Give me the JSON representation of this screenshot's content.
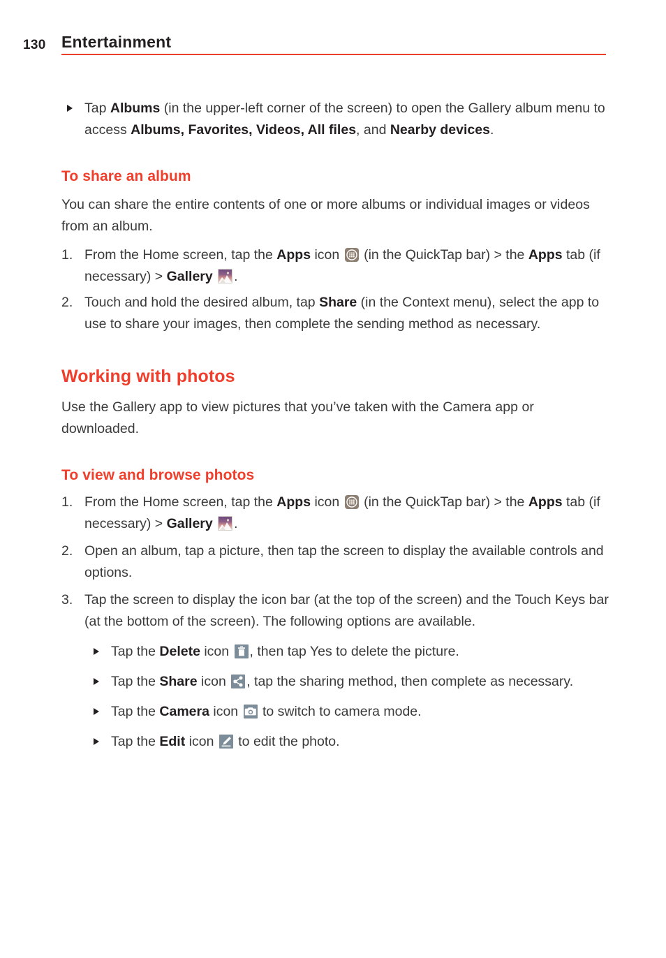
{
  "header": {
    "page_number": "130",
    "title": "Entertainment",
    "rule_color": "#e8402a"
  },
  "colors": {
    "heading_red": "#ef3e2b",
    "body_text": "#3a3a3a",
    "bold_text": "#231f20",
    "apps_icon_bg": "#8d7f72",
    "slate_icon_bg": "#7c8d99"
  },
  "content": {
    "intro_bullet": {
      "bullet_icon": "triangle-right-bullet",
      "part1": "Tap ",
      "bold1": "Albums",
      "part2": " (in the upper-left corner of the screen) to open the Gallery album menu to access ",
      "bold2": "Albums, Favorites, Videos, All files",
      "part3": ", and ",
      "bold3": "Nearby devices",
      "part4": "."
    },
    "share_album_section": {
      "heading": "To share an album",
      "intro": "You can share the entire contents of one or more albums or individual images or videos from an album.",
      "steps": [
        {
          "marker": "1.",
          "part1": "From the Home screen, tap the ",
          "bold1": "Apps",
          "part2": " icon ",
          "icon1": "apps-grid-icon",
          "part3": " (in the QuickTap bar) > the ",
          "bold2": "Apps",
          "part4": " tab (if necessary) > ",
          "bold3": "Gallery",
          "part5": " ",
          "icon2": "gallery-photo-icon",
          "part6": "."
        },
        {
          "marker": "2.",
          "part1": "Touch and hold the desired album, tap ",
          "bold1": "Share",
          "part2": " (in the Context menu), select the app to use to share your images, then complete the sending method as necessary."
        }
      ]
    },
    "working_with_photos_section": {
      "heading": "Working with photos",
      "intro": "Use the Gallery app to view pictures that you’ve taken with the Camera app or downloaded."
    },
    "view_browse_section": {
      "heading": "To view and browse photos",
      "steps": [
        {
          "marker": "1.",
          "part1": "From the Home screen, tap the ",
          "bold1": "Apps",
          "part2": " icon ",
          "icon1": "apps-grid-icon",
          "part3": " (in the QuickTap bar) > the ",
          "bold2": "Apps",
          "part4": " tab (if necessary) > ",
          "bold3": "Gallery",
          "part5": " ",
          "icon2": "gallery-photo-icon",
          "part6": "."
        },
        {
          "marker": "2.",
          "part1": "Open an album, tap a picture, then tap the screen to display the available controls and options."
        },
        {
          "marker": "3.",
          "part1": "Tap the screen to display the icon bar (at the top of the screen) and the Touch Keys bar (at the bottom of the screen). The following options are available."
        }
      ],
      "option_bullets": [
        {
          "bullet_icon": "triangle-right-bullet",
          "part1": "Tap the ",
          "bold1": "Delete",
          "part2": " icon ",
          "icon": "delete-trash-icon",
          "part3": ", then tap Yes to delete the picture."
        },
        {
          "bullet_icon": "triangle-right-bullet",
          "part1": "Tap the ",
          "bold1": "Share",
          "part2": " icon ",
          "icon": "share-nodes-icon",
          "part3": ", tap the sharing method, then complete as necessary."
        },
        {
          "bullet_icon": "triangle-right-bullet",
          "part1": "Tap the ",
          "bold1": "Camera",
          "part2": " icon ",
          "icon": "camera-icon",
          "part3": " to switch to camera mode."
        },
        {
          "bullet_icon": "triangle-right-bullet",
          "part1": "Tap the ",
          "bold1": "Edit",
          "part2": " icon ",
          "icon": "edit-pencil-icon",
          "part3": " to edit the photo."
        }
      ]
    }
  }
}
